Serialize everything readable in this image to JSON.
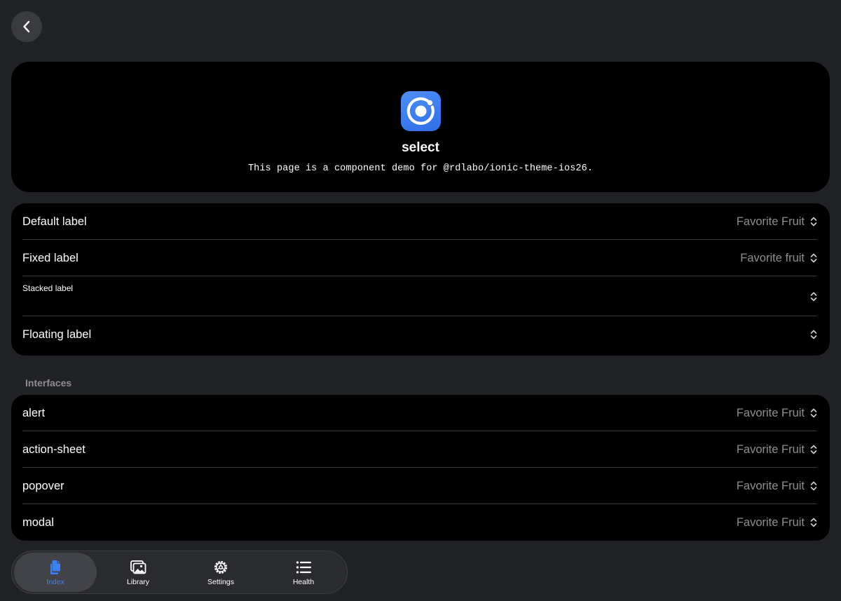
{
  "header": {
    "back_icon": "chevron-left-icon"
  },
  "hero": {
    "logo_icon": "ionic-logo-icon",
    "title": "select",
    "description": "This page is a component demo for @rdlabo/ionic-theme-ios26."
  },
  "labels_list": {
    "items": [
      {
        "label": "Default label",
        "value": "Favorite Fruit"
      },
      {
        "label": "Fixed label",
        "value": "Favorite fruit"
      },
      {
        "label": "Stacked label",
        "value": ""
      },
      {
        "label": "Floating label",
        "value": ""
      }
    ]
  },
  "interfaces": {
    "header": "Interfaces",
    "items": [
      {
        "label": "alert",
        "value": "Favorite Fruit"
      },
      {
        "label": "action-sheet",
        "value": "Favorite Fruit"
      },
      {
        "label": "popover",
        "value": "Favorite Fruit"
      },
      {
        "label": "modal",
        "value": "Favorite Fruit"
      }
    ]
  },
  "tabbar": {
    "tabs": [
      {
        "label": "Index",
        "icon": "documents-icon",
        "active": true
      },
      {
        "label": "Library",
        "icon": "images-icon",
        "active": false
      },
      {
        "label": "Settings",
        "icon": "gear-icon",
        "active": false
      },
      {
        "label": "Health",
        "icon": "list-icon",
        "active": false
      }
    ]
  },
  "colors": {
    "background": "#202226",
    "card": "#000000",
    "accent": "#3b82f6",
    "secondary_text": "#8e8e93"
  }
}
